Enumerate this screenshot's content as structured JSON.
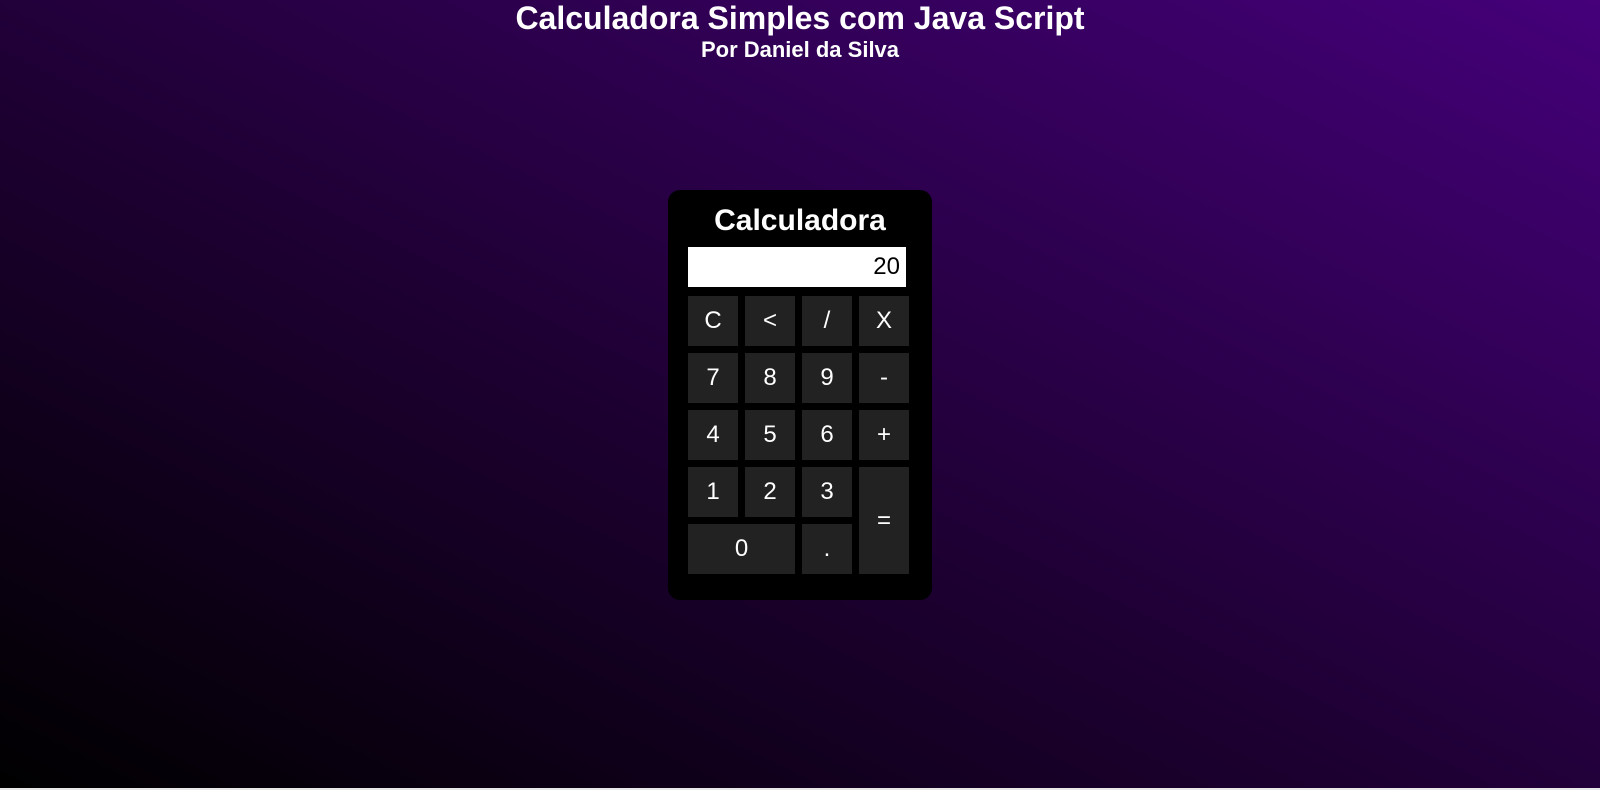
{
  "page": {
    "title": "Calculadora Simples com Java Script",
    "subtitle": "Por Daniel da Silva"
  },
  "calculator": {
    "title": "Calculadora",
    "display_value": "20",
    "keys": {
      "clear": "C",
      "backspace": "<",
      "divide": "/",
      "multiply": "X",
      "seven": "7",
      "eight": "8",
      "nine": "9",
      "minus": "-",
      "four": "4",
      "five": "5",
      "six": "6",
      "plus": "+",
      "one": "1",
      "two": "2",
      "three": "3",
      "equals": "=",
      "zero": "0",
      "decimal": "."
    }
  },
  "colors": {
    "background_start": "#000000",
    "background_end": "#45007a",
    "calculator_body": "#000000",
    "key_background": "#222222",
    "display_background": "#ffffff"
  }
}
